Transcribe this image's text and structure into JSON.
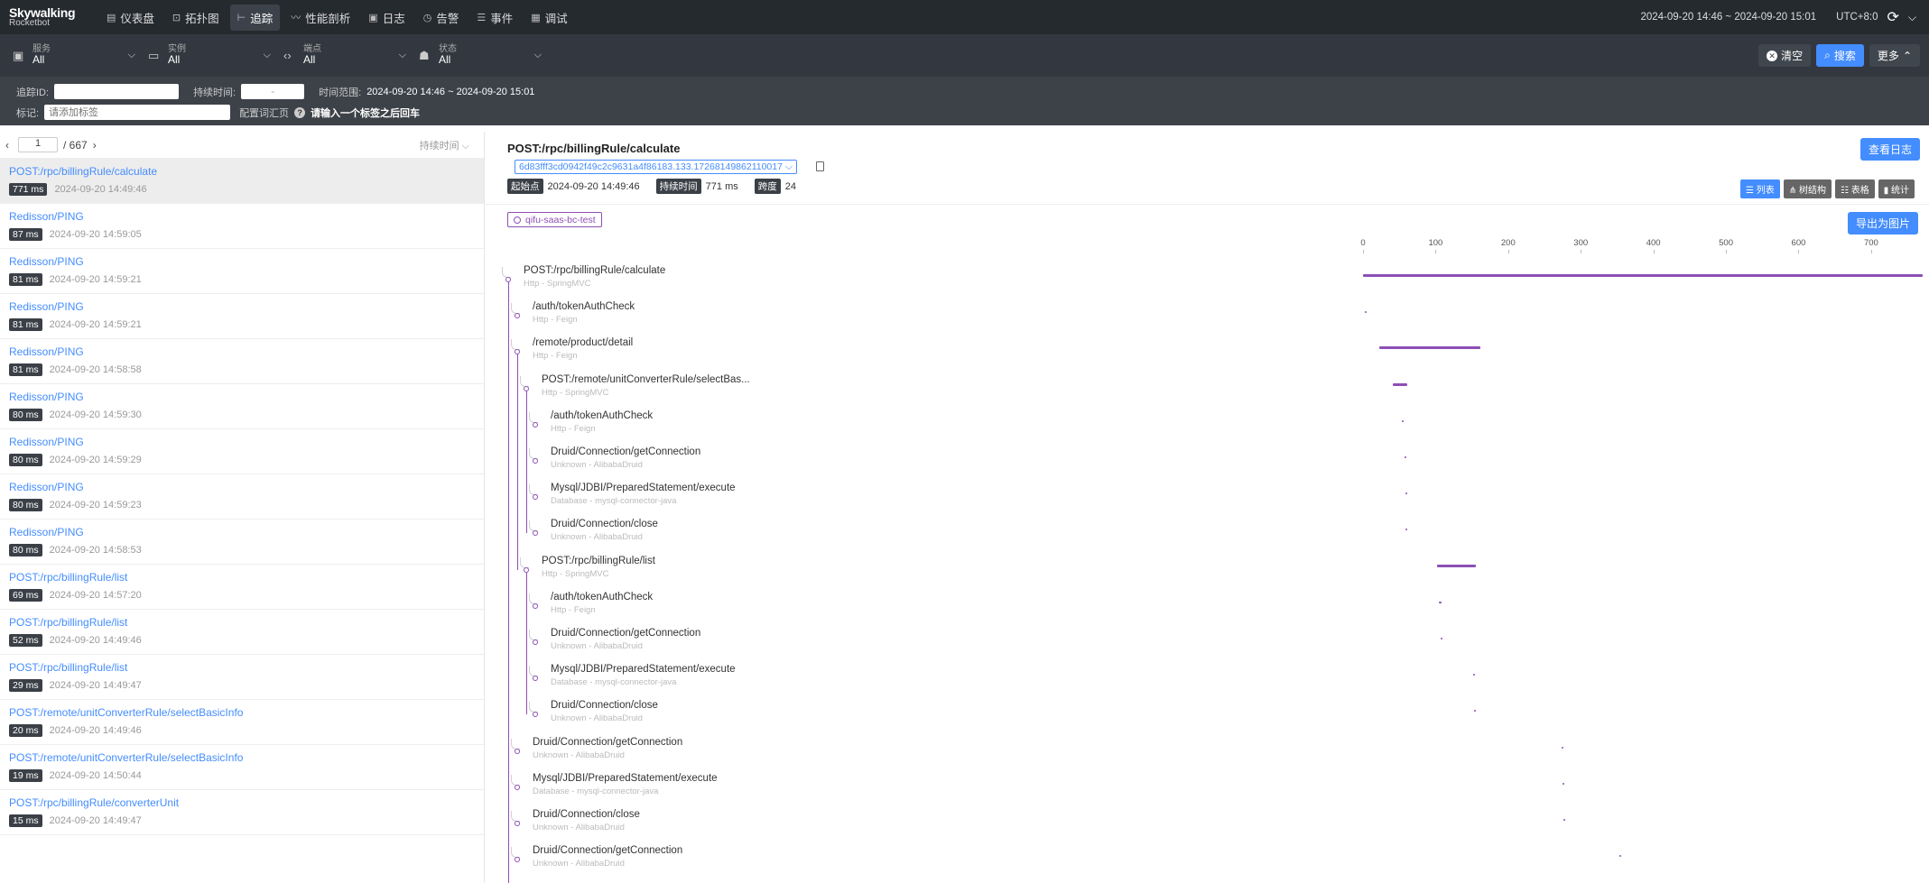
{
  "app": {
    "logo_main": "Skywalking",
    "logo_sub": "Rocketbot"
  },
  "nav": {
    "items": [
      {
        "icon": "dashboard-icon",
        "glyph": "▤",
        "label": "仪表盘"
      },
      {
        "icon": "topology-icon",
        "glyph": "⊡",
        "label": "拓扑图"
      },
      {
        "icon": "trace-icon",
        "glyph": "⊢",
        "label": "追踪"
      },
      {
        "icon": "profile-icon",
        "glyph": "〰",
        "label": "性能剖析"
      },
      {
        "icon": "log-icon",
        "glyph": "▣",
        "label": "日志"
      },
      {
        "icon": "alarm-icon",
        "glyph": "◷",
        "label": "告警"
      },
      {
        "icon": "event-icon",
        "glyph": "☰",
        "label": "事件"
      },
      {
        "icon": "debug-icon",
        "glyph": "▦",
        "label": "调试"
      }
    ],
    "time_range": "2024-09-20 14:46 ~ 2024-09-20 15:01",
    "timezone": "UTC+8:0"
  },
  "filters": {
    "selects": [
      {
        "icon": "service-icon",
        "glyph": "▣",
        "label": "服务",
        "value": "All"
      },
      {
        "icon": "instance-icon",
        "glyph": "▭",
        "label": "实例",
        "value": "All"
      },
      {
        "icon": "endpoint-icon",
        "glyph": "‹›",
        "label": "端点",
        "value": "All"
      },
      {
        "icon": "status-icon",
        "glyph": "☗",
        "label": "状态",
        "value": "All"
      }
    ],
    "clear_label": "清空",
    "search_label": "搜索",
    "more_label": "更多"
  },
  "search": {
    "trace_id_label": "追踪ID:",
    "duration_label": "持续时间:",
    "duration_sep": "-",
    "time_range_label": "时间范围:",
    "time_range_value": "2024-09-20 14:46 ~ 2024-09-20 15:01",
    "tags_label": "标记:",
    "tags_placeholder": "请添加标签",
    "config_label": "配置词汇页",
    "hint": "请输入一个标签之后回车"
  },
  "list": {
    "page": "1",
    "total": "/ 667",
    "sort_label": "持续时间",
    "traces": [
      {
        "name": "POST:/rpc/billingRule/calculate",
        "duration": "771 ms",
        "time": "2024-09-20 14:49:46"
      },
      {
        "name": "Redisson/PING",
        "duration": "87 ms",
        "time": "2024-09-20 14:59:05"
      },
      {
        "name": "Redisson/PING",
        "duration": "81 ms",
        "time": "2024-09-20 14:59:21"
      },
      {
        "name": "Redisson/PING",
        "duration": "81 ms",
        "time": "2024-09-20 14:59:21"
      },
      {
        "name": "Redisson/PING",
        "duration": "81 ms",
        "time": "2024-09-20 14:58:58"
      },
      {
        "name": "Redisson/PING",
        "duration": "80 ms",
        "time": "2024-09-20 14:59:30"
      },
      {
        "name": "Redisson/PING",
        "duration": "80 ms",
        "time": "2024-09-20 14:59:29"
      },
      {
        "name": "Redisson/PING",
        "duration": "80 ms",
        "time": "2024-09-20 14:59:23"
      },
      {
        "name": "Redisson/PING",
        "duration": "80 ms",
        "time": "2024-09-20 14:58:53"
      },
      {
        "name": "POST:/rpc/billingRule/list",
        "duration": "69 ms",
        "time": "2024-09-20 14:57:20"
      },
      {
        "name": "POST:/rpc/billingRule/list",
        "duration": "52 ms",
        "time": "2024-09-20 14:49:46"
      },
      {
        "name": "POST:/rpc/billingRule/list",
        "duration": "29 ms",
        "time": "2024-09-20 14:49:47"
      },
      {
        "name": "POST:/remote/unitConverterRule/selectBasicInfo",
        "duration": "20 ms",
        "time": "2024-09-20 14:49:46"
      },
      {
        "name": "POST:/remote/unitConverterRule/selectBasicInfo",
        "duration": "19 ms",
        "time": "2024-09-20 14:50:44"
      },
      {
        "name": "POST:/rpc/billingRule/converterUnit",
        "duration": "15 ms",
        "time": "2024-09-20 14:49:47"
      }
    ]
  },
  "detail": {
    "title": "POST:/rpc/billingRule/calculate",
    "view_log_label": "查看日志",
    "trace_id": "6d83fff3cd0942f49c2c9631a4f86183.133.17268149862110017",
    "start_label": "起始点",
    "start_value": "2024-09-20 14:49:46",
    "duration_label": "持续时间",
    "duration_value": "771 ms",
    "span_label": "跨度",
    "span_value": "24",
    "views": [
      {
        "icon": "list-icon",
        "glyph": "☰",
        "label": "列表"
      },
      {
        "icon": "tree-icon",
        "glyph": "⋔",
        "label": "树结构"
      },
      {
        "icon": "table-icon",
        "glyph": "☷",
        "label": "表格"
      },
      {
        "icon": "stats-icon",
        "glyph": "▮",
        "label": "统计"
      }
    ],
    "service_tag": "qifu-saas-bc-test",
    "export_label": "导出为图片",
    "axis": {
      "min": 0,
      "max": 771,
      "ticks": [
        "0",
        "100",
        "200",
        "300",
        "400",
        "500",
        "600",
        "700"
      ],
      "tick_values": [
        0,
        100,
        200,
        300,
        400,
        500,
        600,
        700
      ]
    },
    "spans": [
      {
        "name": "POST:/rpc/billingRule/calculate",
        "type": "Http - SpringMVC",
        "depth": 0,
        "start": 0,
        "end": 771
      },
      {
        "name": "/auth/tokenAuthCheck",
        "type": "Http - Feign",
        "depth": 1,
        "start": 2,
        "end": 4
      },
      {
        "name": "/remote/product/detail",
        "type": "Http - Feign",
        "depth": 1,
        "start": 22,
        "end": 162
      },
      {
        "name": "POST:/remote/unitConverterRule/selectBas...",
        "type": "Http - SpringMVC",
        "depth": 2,
        "start": 41,
        "end": 61
      },
      {
        "name": "/auth/tokenAuthCheck",
        "type": "Http - Feign",
        "depth": 3,
        "start": 54,
        "end": 56
      },
      {
        "name": "Druid/Connection/getConnection",
        "type": "Unknown - AlibabaDruid",
        "depth": 3,
        "start": 57,
        "end": 58
      },
      {
        "name": "Mysql/JDBI/PreparedStatement/execute",
        "type": "Database - mysql-connector-java",
        "depth": 3,
        "start": 58,
        "end": 60
      },
      {
        "name": "Druid/Connection/close",
        "type": "Unknown - AlibabaDruid",
        "depth": 3,
        "start": 59,
        "end": 60
      },
      {
        "name": "POST:/rpc/billingRule/list",
        "type": "Http - SpringMVC",
        "depth": 2,
        "start": 102,
        "end": 155
      },
      {
        "name": "/auth/tokenAuthCheck",
        "type": "Http - Feign",
        "depth": 3,
        "start": 105,
        "end": 108
      },
      {
        "name": "Druid/Connection/getConnection",
        "type": "Unknown - AlibabaDruid",
        "depth": 3,
        "start": 107,
        "end": 108
      },
      {
        "name": "Mysql/JDBI/PreparedStatement/execute",
        "type": "Database - mysql-connector-java",
        "depth": 3,
        "start": 152,
        "end": 153
      },
      {
        "name": "Druid/Connection/close",
        "type": "Unknown - AlibabaDruid",
        "depth": 3,
        "start": 153,
        "end": 154
      },
      {
        "name": "Druid/Connection/getConnection",
        "type": "Unknown - AlibabaDruid",
        "depth": 1,
        "start": 274,
        "end": 275
      },
      {
        "name": "Mysql/JDBI/PreparedStatement/execute",
        "type": "Database - mysql-connector-java",
        "depth": 1,
        "start": 275,
        "end": 277
      },
      {
        "name": "Druid/Connection/close",
        "type": "Unknown - AlibabaDruid",
        "depth": 1,
        "start": 276,
        "end": 277
      },
      {
        "name": "Druid/Connection/getConnection",
        "type": "Unknown - AlibabaDruid",
        "depth": 1,
        "start": 353,
        "end": 354
      }
    ]
  }
}
